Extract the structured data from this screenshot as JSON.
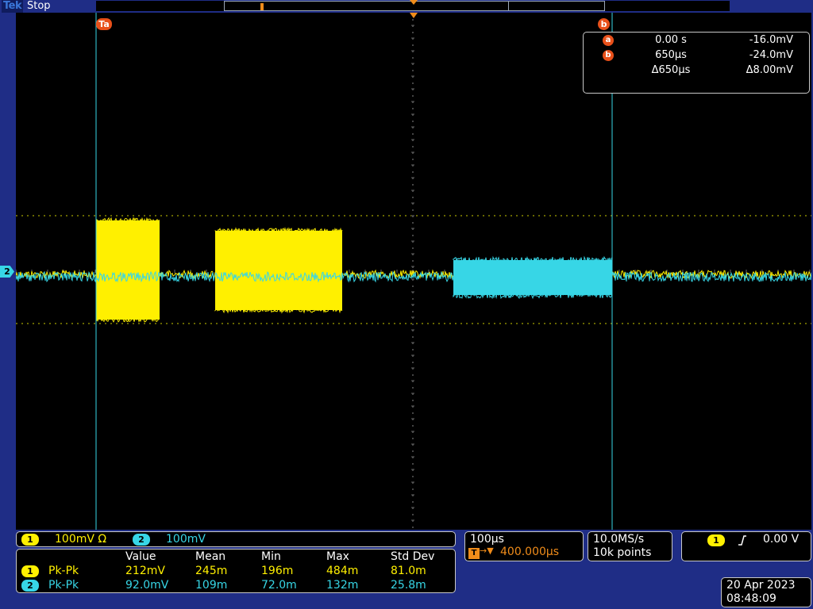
{
  "topbar": {
    "brand": "Tek",
    "acq_state": "Stop"
  },
  "colors": {
    "ch1": "#fff000",
    "ch2": "#37d6e6",
    "cursor": "#e8501a",
    "trigger": "#f08c1a",
    "frame": "#1f2d86"
  },
  "plot": {
    "ch2_marker": "2",
    "cursor_a_label": "Ta",
    "cursor_b_label": "b"
  },
  "cursor_readout": {
    "a": {
      "flag": "a",
      "time": "0.00 s",
      "volt": "-16.0mV"
    },
    "b": {
      "flag": "b",
      "time": "650µs",
      "volt": "-24.0mV"
    },
    "delta": {
      "time": "Δ650µs",
      "volt": "Δ8.00mV"
    }
  },
  "channels": {
    "ch1": {
      "badge": "1",
      "scale": "100mV Ω"
    },
    "ch2": {
      "badge": "2",
      "scale": "100mV"
    }
  },
  "measurements": {
    "headers": [
      "Value",
      "Mean",
      "Min",
      "Max",
      "Std Dev"
    ],
    "rows": [
      {
        "badge": "1",
        "type": "Pk-Pk",
        "value": "212mV",
        "mean": "245m",
        "min": "196m",
        "max": "484m",
        "std": "81.0m"
      },
      {
        "badge": "2",
        "type": "Pk-Pk",
        "value": "92.0mV",
        "mean": "109m",
        "min": "72.0m",
        "max": "132m",
        "std": "25.8m"
      }
    ]
  },
  "timebase": {
    "scale": "100µs",
    "trigger_icon": "T",
    "position": "400.000µs"
  },
  "acquisition": {
    "rate": "10.0MS/s",
    "points": "10k points"
  },
  "trigger": {
    "badge": "1",
    "slope_icon": "rising-edge-icon",
    "level": "0.00 V"
  },
  "datetime": {
    "date": "20 Apr 2023",
    "time": "08:48:09"
  }
}
